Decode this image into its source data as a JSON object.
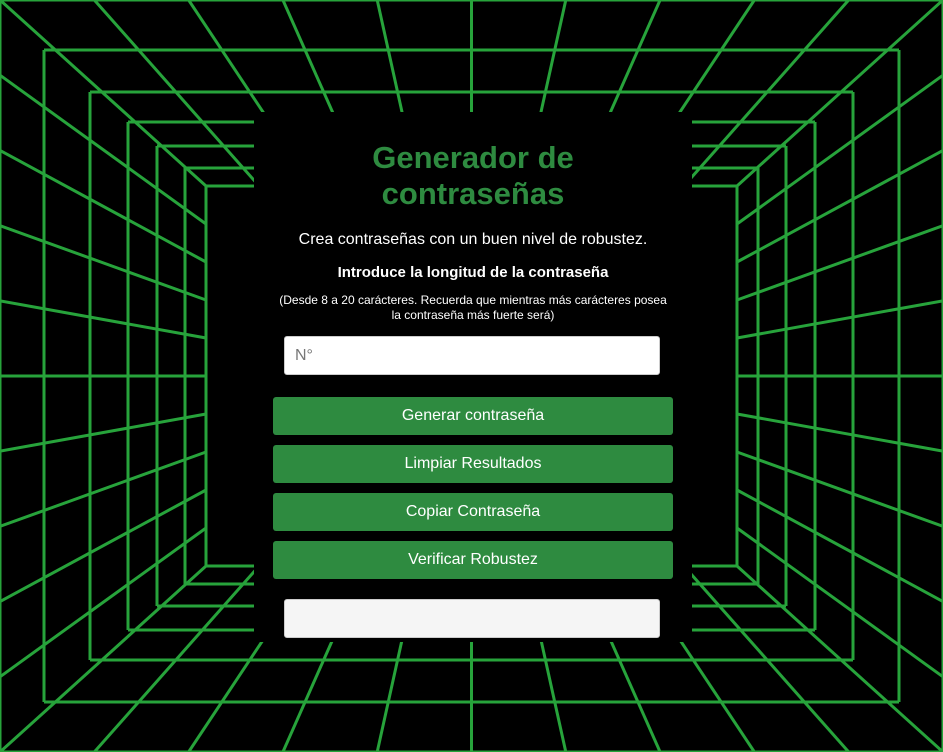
{
  "colors": {
    "accent": "#2e8b40",
    "grid": "#27a33b",
    "background": "#000000"
  },
  "header": {
    "title": "Generador de contraseñas",
    "subtitle": "Crea contraseñas con un buen nivel de robustez."
  },
  "form": {
    "length_label": "Introduce la longitud de la contraseña",
    "length_note": "(Desde 8 a 20 carácteres. Recuerda que mientras más carácteres posea la contraseña más fuerte será)",
    "length_placeholder": "N°",
    "length_value": "",
    "result_value": ""
  },
  "buttons": {
    "generate": "Generar contraseña",
    "clear": "Limpiar Resultados",
    "copy": "Copiar Contraseña",
    "verify": "Verificar Robustez"
  }
}
